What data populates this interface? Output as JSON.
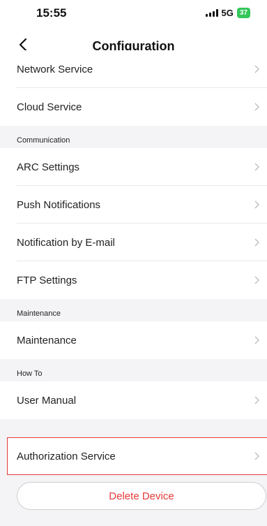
{
  "status_bar": {
    "time": "15:55",
    "network": "5G",
    "battery": "37"
  },
  "nav": {
    "title": "Configuration",
    "back_icon": "chevron-left-icon"
  },
  "groups": {
    "top_items": [
      {
        "label": "Network Service"
      },
      {
        "label": "Cloud Service"
      }
    ],
    "communication": {
      "header": "Communication",
      "items": [
        {
          "label": "ARC Settings"
        },
        {
          "label": "Push Notifications"
        },
        {
          "label": "Notification by E-mail"
        },
        {
          "label": "FTP Settings"
        }
      ]
    },
    "maintenance": {
      "header": "Maintenance",
      "items": [
        {
          "label": "Maintenance"
        }
      ]
    },
    "how_to": {
      "header": "How To",
      "items": [
        {
          "label": "User Manual"
        }
      ]
    },
    "authorization": {
      "label": "Authorization Service"
    }
  },
  "delete_button": "Delete Device",
  "colors": {
    "accent_red": "#e43a3a",
    "battery_green": "#34c759",
    "background": "#f4f4f6"
  }
}
